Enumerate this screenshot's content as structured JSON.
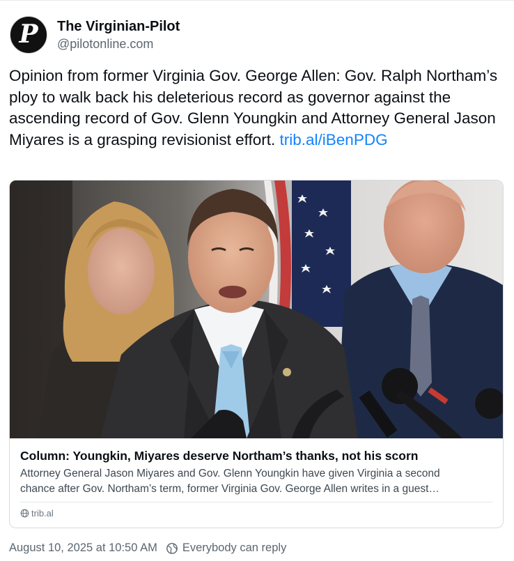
{
  "post": {
    "author": {
      "display_name": "The Virginian-Pilot",
      "handle": "@pilotonline.com",
      "avatar_icon": "newspaper-logo-icon",
      "avatar_letter": "P"
    },
    "text": "Opinion from former Virginia Gov. George Allen: Gov. Ralph Northam’s ploy to walk back his deleterious record as governor against the ascending record of Gov. Glenn Youngkin and Attorney General Jason Miyares is a grasping revisionist effort.",
    "link_text": "trib.al/iBenPDG",
    "embed": {
      "image_alt": "Attorney General Jason Miyares speaking at a podium with microphones, flanked by two people, US flag behind",
      "title": "Column: Youngkin, Miyares deserve Northam’s thanks, not his scorn",
      "description_line1": "Attorney General Jason Miyares and Gov. Glenn Youngkin have given Virginia a second",
      "description_line2": "chance after Gov. Northam’s term, former Virginia Gov. George Allen writes in a guest…",
      "domain": "trib.al"
    },
    "timestamp": "August 10, 2025 at 10:50 AM",
    "reply_setting": "Everybody can reply"
  },
  "colors": {
    "link": "#1083fe",
    "text": "#0b0f14",
    "muted": "#5b6670",
    "border": "#d6dbe0"
  }
}
